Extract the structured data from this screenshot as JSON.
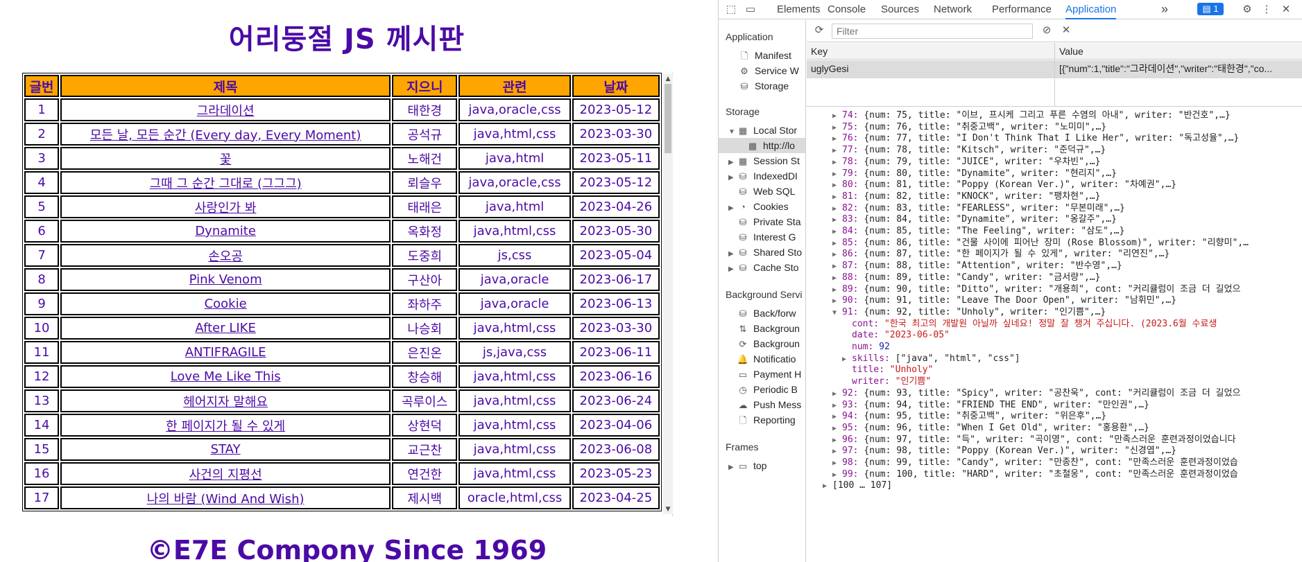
{
  "page": {
    "title": "어리둥절 JS 께시판",
    "footer": "©E7E Compony Since 1969",
    "table_headers": [
      "글번",
      "제목",
      "지으니",
      "관련",
      "날짜"
    ],
    "rows": [
      {
        "num": "1",
        "title": "그라데이션",
        "writer": "태한경",
        "rel": "java,oracle,css",
        "date": "2023-05-12"
      },
      {
        "num": "2",
        "title": "모든 날, 모든 순간 (Every day, Every Moment)",
        "writer": "공석규",
        "rel": "java,html,css",
        "date": "2023-03-30"
      },
      {
        "num": "3",
        "title": "꽃",
        "writer": "노해건",
        "rel": "java,html",
        "date": "2023-05-11"
      },
      {
        "num": "4",
        "title": "그때 그 순간 그대로 (그그그)",
        "writer": "뢰슬우",
        "rel": "java,oracle,css",
        "date": "2023-05-12"
      },
      {
        "num": "5",
        "title": "사랑인가 봐",
        "writer": "태래은",
        "rel": "java,html",
        "date": "2023-04-26"
      },
      {
        "num": "6",
        "title": "Dynamite",
        "writer": "옥화정",
        "rel": "java,html,css",
        "date": "2023-05-30"
      },
      {
        "num": "7",
        "title": "손오공",
        "writer": "도중희",
        "rel": "js,css",
        "date": "2023-05-04"
      },
      {
        "num": "8",
        "title": "Pink Venom",
        "writer": "구산아",
        "rel": "java,oracle",
        "date": "2023-06-17"
      },
      {
        "num": "9",
        "title": "Cookie",
        "writer": "좌하주",
        "rel": "java,oracle",
        "date": "2023-06-13"
      },
      {
        "num": "10",
        "title": "After LIKE",
        "writer": "나승회",
        "rel": "java,html,css",
        "date": "2023-03-30"
      },
      {
        "num": "11",
        "title": "ANTIFRAGILE",
        "writer": "은진온",
        "rel": "js,java,css",
        "date": "2023-06-11"
      },
      {
        "num": "12",
        "title": "Love Me Like This",
        "writer": "창승해",
        "rel": "java,html,css",
        "date": "2023-06-16"
      },
      {
        "num": "13",
        "title": "헤어지자 말해요",
        "writer": "곡루이스",
        "rel": "java,html,css",
        "date": "2023-06-24"
      },
      {
        "num": "14",
        "title": "한 페이지가 될 수 있게",
        "writer": "상현덕",
        "rel": "java,html,css",
        "date": "2023-04-06"
      },
      {
        "num": "15",
        "title": "STAY",
        "writer": "교근찬",
        "rel": "java,html,css",
        "date": "2023-06-08"
      },
      {
        "num": "16",
        "title": "사건의 지평선",
        "writer": "연건한",
        "rel": "java,html,css",
        "date": "2023-05-23"
      },
      {
        "num": "17",
        "title": "나의 바람 (Wind And Wish)",
        "writer": "제시백",
        "rel": "oracle,html,css",
        "date": "2023-04-25"
      }
    ]
  },
  "devtools": {
    "tabs": [
      "Elements",
      "Console",
      "Sources",
      "Network",
      "Performance",
      "Application"
    ],
    "active_tab": "Application",
    "more_tabs": "»",
    "issues_count": "1",
    "sidebar": {
      "app_head": "Application",
      "app_items": [
        "Manifest",
        "Service W",
        "Storage"
      ],
      "storage_head": "Storage",
      "storage_items": [
        "Local Stor",
        "http://lo",
        "Session St",
        "IndexedDI",
        "Web SQL",
        "Cookies",
        "Private Sta",
        "Interest G",
        "Shared Sto",
        "Cache Sto"
      ],
      "bg_head": "Background Servi",
      "bg_items": [
        "Back/forw",
        "Backgroun",
        "Backgroun",
        "Notificatio",
        "Payment H",
        "Periodic B",
        "Push Mess",
        "Reporting"
      ],
      "frames_head": "Frames",
      "frames_items": [
        "top"
      ]
    },
    "filter_placeholder": "Filter",
    "kv_headers": {
      "key": "Key",
      "value": "Value"
    },
    "kv_row": {
      "key": "uglyGesi",
      "value": "[{\"num\":1,\"title\":\"그라데이션\",\"writer\":\"태한경\",\"co..."
    },
    "preview_lines": [
      {
        "idx": "74:",
        "text": "{num: 75, title: \"이브, 프시케 그리고 푸른 수염의 아내\", writer: \"반건호\",…}"
      },
      {
        "idx": "75:",
        "text": "{num: 76, title: \"취중고백\", writer: \"노미미\",…}"
      },
      {
        "idx": "76:",
        "text": "{num: 77, title: \"I Don't Think That I Like Her\", writer: \"독고성율\",…}"
      },
      {
        "idx": "77:",
        "text": "{num: 78, title: \"Kitsch\", writer: \"준덕규\",…}"
      },
      {
        "idx": "78:",
        "text": "{num: 79, title: \"JUICE\", writer: \"우차빈\",…}"
      },
      {
        "idx": "79:",
        "text": "{num: 80, title: \"Dynamite\", writer: \"현리지\",…}"
      },
      {
        "idx": "80:",
        "text": "{num: 81, title: \"Poppy (Korean Ver.)\", writer: \"차예권\",…}"
      },
      {
        "idx": "81:",
        "text": "{num: 82, title: \"KNOCK\", writer: \"팽차현\",…}"
      },
      {
        "idx": "82:",
        "text": "{num: 83, title: \"FEARLESS\", writer: \"무본미래\",…}"
      },
      {
        "idx": "83:",
        "text": "{num: 84, title: \"Dynamite\", writer: \"옹갈주\",…}"
      },
      {
        "idx": "84:",
        "text": "{num: 85, title: \"The Feeling\", writer: \"삼도\",…}"
      },
      {
        "idx": "85:",
        "text": "{num: 86, title: \"건물 사이에 피어난 장미 (Rose Blossom)\", writer: \"리향미\",…"
      },
      {
        "idx": "86:",
        "text": "{num: 87, title: \"한 페이지가 될 수 있게\", writer: \"리연진\",…}"
      },
      {
        "idx": "87:",
        "text": "{num: 88, title: \"Attention\", writer: \"반수영\",…}"
      },
      {
        "idx": "88:",
        "text": "{num: 89, title: \"Candy\", writer: \"금서량\",…}"
      },
      {
        "idx": "89:",
        "text": "{num: 90, title: \"Ditto\", writer: \"개용희\", cont: \"커리큘럼이 조금 더 길었으"
      },
      {
        "idx": "90:",
        "text": "{num: 91, title: \"Leave The Door Open\", writer: \"남휘민\",…}"
      },
      {
        "idx": "91:",
        "text": "{num: 92, title: \"Unholy\", writer: \"인기쁨\",…}"
      }
    ],
    "expanded": {
      "cont_key": "cont:",
      "cont_val": "\"한국 최고의 개발원 아닐까 싶네요! 정말 잘 챙겨 주십니다. (2023.6월 수료생",
      "date_key": "date:",
      "date_val": "\"2023-06-05\"",
      "num_key": "num:",
      "num_val": "92",
      "skills_key": "skills:",
      "skills_val": "[\"java\", \"html\", \"css\"]",
      "title_key": "title:",
      "title_val": "\"Unholy\"",
      "writer_key": "writer:",
      "writer_val": "\"인기쁨\""
    },
    "preview_tail": [
      {
        "idx": "92:",
        "text": "{num: 93, title: \"Spicy\", writer: \"공찬욱\", cont: \"커리큘럼이 조금 더 길었으"
      },
      {
        "idx": "93:",
        "text": "{num: 94, title: \"FRIEND THE END\", writer: \"만인권\",…}"
      },
      {
        "idx": "94:",
        "text": "{num: 95, title: \"취중고백\", writer: \"위은후\",…}"
      },
      {
        "idx": "95:",
        "text": "{num: 96, title: \"When I Get Old\", writer: \"홍용환\",…}"
      },
      {
        "idx": "96:",
        "text": "{num: 97, title: \"득\", writer: \"곡이영\", cont: \"만족스러운 훈련과정이었습니다"
      },
      {
        "idx": "97:",
        "text": "{num: 98, title: \"Poppy (Korean Ver.)\", writer: \"신경엽\",…}"
      },
      {
        "idx": "98:",
        "text": "{num: 99, title: \"Candy\", writer: \"만종찬\", cont: \"만족스러운 훈련과정이었습"
      },
      {
        "idx": "99:",
        "text": "{num: 100, title: \"HARD\", writer: \"초철웅\", cont: \"만족스러운 훈련과정이었습"
      }
    ],
    "range_label": "[100 … 107]",
    "colors": {
      "accent": "#1a73e8",
      "page_purple": "#4b0aa6",
      "header_orange": "#ffa500"
    }
  }
}
